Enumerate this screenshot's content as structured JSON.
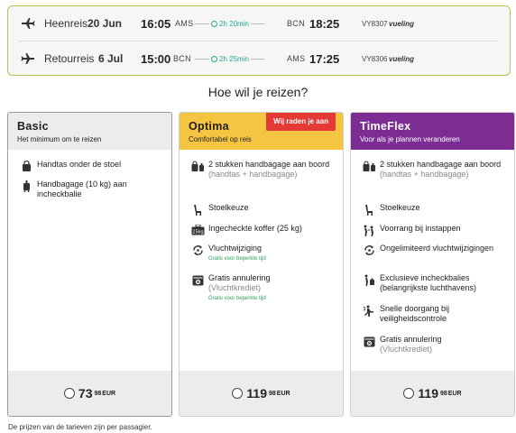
{
  "flights": {
    "outbound": {
      "direction": "Heenreis",
      "date": "20 Jun",
      "depart_time": "16:05",
      "depart_code": "AMS",
      "duration": "2h 20min",
      "arrive_code": "BCN",
      "arrive_time": "18:25",
      "flight_number": "VY8307",
      "airline": "vueling"
    },
    "return": {
      "direction": "Retourreis",
      "date": "6 Jul",
      "depart_time": "15:00",
      "depart_code": "BCN",
      "duration": "2h 25min",
      "arrive_code": "AMS",
      "arrive_time": "17:25",
      "flight_number": "VY8306",
      "airline": "vueling"
    }
  },
  "heading": "Hoe wil je reizen?",
  "fares": {
    "basic": {
      "name": "Basic",
      "subtitle": "Het minimum om te reizen",
      "features": [
        {
          "icon": "handbag-icon",
          "text": "Handtas onder de stoel"
        },
        {
          "icon": "trolley-icon",
          "text": "Handbagage (10 kg) aan incheckbalie"
        }
      ],
      "price_main": "73",
      "price_cents": "98",
      "currency": "EUR"
    },
    "optima": {
      "name": "Optima",
      "subtitle": "Comfortabel op reis",
      "badge": "Wij raden je aan",
      "features": [
        {
          "icon": "bags-icon",
          "text": "2 stukken handbagage aan boord",
          "note": "(handtas + handbagage)"
        },
        {
          "icon": "seat-icon",
          "text": "Stoelkeuze"
        },
        {
          "icon": "suitcase-icon",
          "text": "Ingecheckte koffer (25 kg)"
        },
        {
          "icon": "change-icon",
          "text": "Vluchtwijziging",
          "promo": "Gratis voor beperkte tijd"
        },
        {
          "icon": "cancel-icon",
          "text": "Gratis annulering",
          "note": "(Vluchtkrediet)",
          "promo": "Gratis voor beperkte tijd"
        }
      ],
      "price_main": "119",
      "price_cents": "98",
      "currency": "EUR"
    },
    "timeflex": {
      "name": "TimeFlex",
      "subtitle": "Voor als je plannen veranderen",
      "features": [
        {
          "icon": "bags-icon",
          "text": "2 stukken handbagage aan boord",
          "note": "(handtas + handbagage)"
        },
        {
          "icon": "seat-icon",
          "text": "Stoelkeuze"
        },
        {
          "icon": "priority-icon",
          "text": "Voorrang bij instappen"
        },
        {
          "icon": "change-icon",
          "text": "Ongelimiteerd vluchtwijzigingen"
        },
        {
          "icon": "checkin-icon",
          "text": "Exclusieve incheckbalies (belangrijkste luchthavens)"
        },
        {
          "icon": "security-icon",
          "text": "Snelle doorgang bij veiligheidscontrole"
        },
        {
          "icon": "cancel-icon",
          "text": "Gratis annulering",
          "note": "(Vluchtkrediet)"
        }
      ],
      "price_main": "119",
      "price_cents": "98",
      "currency": "EUR"
    }
  },
  "footnote": "De prijzen van de tarieven zijn per passagier.",
  "colors": {
    "accent_green": "#a8c75a",
    "optima_yellow": "#f5c542",
    "timeflex_purple": "#7b2d93",
    "badge_red": "#e53935",
    "duration_teal": "#26a596",
    "promo_green": "#2f9e5b"
  }
}
